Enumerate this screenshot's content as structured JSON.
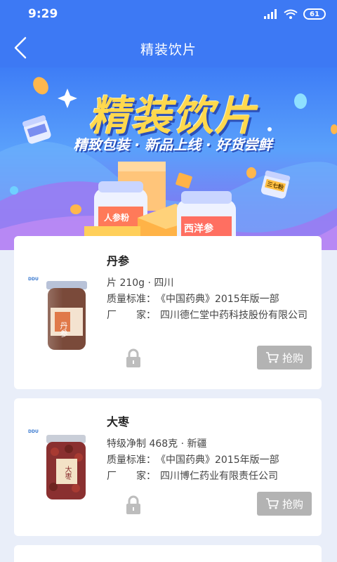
{
  "status_bar": {
    "time": "9:29",
    "battery": "61"
  },
  "header": {
    "title": "精装饮片"
  },
  "banner": {
    "title": "精装饮片",
    "subtitle": "精致包装 · 新品上线 · 好货尝鲜",
    "jar_labels": [
      "西洋参",
      "人参粉",
      "三七粉"
    ]
  },
  "products": [
    {
      "name": "丹参",
      "spec": "片 210g · 四川",
      "standard_label": "质量标准：",
      "standard": "《中国药典》2015年版一部",
      "maker_label": "厂　　家：",
      "maker": "四川德仁堂中药科技股份有限公司",
      "buy_label": "抢购",
      "jar_label": "丹参",
      "brand": "DDU"
    },
    {
      "name": "大枣",
      "spec": "特级净制 468克 · 新疆",
      "standard_label": "质量标准：",
      "standard": "《中国药典》2015年版一部",
      "maker_label": "厂　　家：",
      "maker": "四川博仁药业有限责任公司",
      "buy_label": "抢购",
      "jar_label": "大枣",
      "brand": "DDU"
    }
  ]
}
